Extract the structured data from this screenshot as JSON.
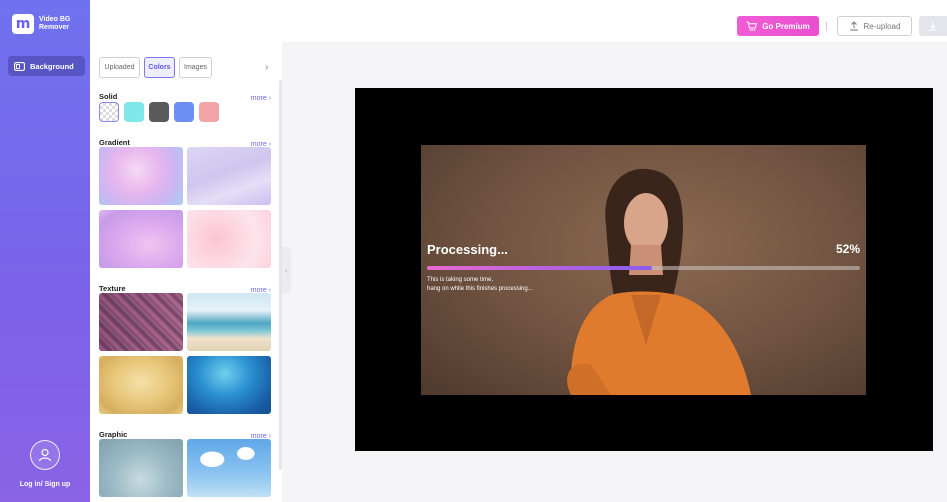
{
  "app": {
    "logo_text_line1": "Video BG",
    "logo_text_line2": "Remover",
    "logo_letter": "m"
  },
  "sidebar": {
    "items": [
      {
        "label": "Background",
        "icon": "video-icon"
      }
    ],
    "login_label": "Log in/ Sign up"
  },
  "header": {
    "premium_label": "Go Premium",
    "reupload_label": "Re-upload",
    "download_icon": "download-icon"
  },
  "panel": {
    "tabs": [
      {
        "label": "Uploaded",
        "active": false
      },
      {
        "label": "Colors",
        "active": true
      },
      {
        "label": "Images",
        "active": false
      }
    ],
    "more_label": "more",
    "sections": {
      "solid": "Solid",
      "gradient": "Gradient",
      "texture": "Texture",
      "graphic": "Graphic"
    },
    "solid_colors": [
      "transparent",
      "#7ee8e8",
      "#5a5a5a",
      "#6b8ff2",
      "#f2a3a8"
    ]
  },
  "processing": {
    "title": "Processing...",
    "percent_label": "52%",
    "progress": 0.52,
    "note_line1": "This is taking some time,",
    "note_line2": "hang on while this finishes processing..."
  },
  "colors": {
    "accent": "#6a66e8",
    "premium": "#ec54d2"
  }
}
